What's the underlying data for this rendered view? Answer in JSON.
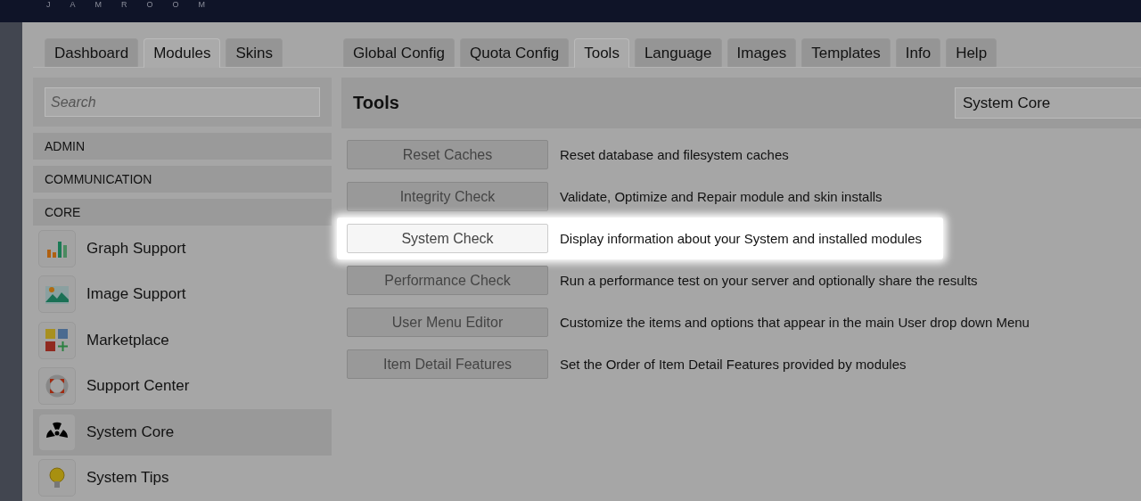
{
  "header": {
    "logo": "JAMROOM"
  },
  "left_tabs": [
    {
      "label": "Dashboard",
      "selected": false
    },
    {
      "label": "Modules",
      "selected": true
    },
    {
      "label": "Skins",
      "selected": false
    }
  ],
  "right_tabs": [
    {
      "label": "Global Config",
      "selected": false
    },
    {
      "label": "Quota Config",
      "selected": false
    },
    {
      "label": "Tools",
      "selected": true
    },
    {
      "label": "Language",
      "selected": false
    },
    {
      "label": "Images",
      "selected": false
    },
    {
      "label": "Templates",
      "selected": false
    },
    {
      "label": "Info",
      "selected": false
    },
    {
      "label": "Help",
      "selected": false
    }
  ],
  "sidebar": {
    "search": {
      "placeholder": "Search"
    },
    "categories": [
      "ADMIN",
      "COMMUNICATION",
      "CORE"
    ],
    "modules": [
      {
        "name": "Graph Support",
        "kind": "graph",
        "selected": false
      },
      {
        "name": "Image Support",
        "kind": "image",
        "selected": false
      },
      {
        "name": "Marketplace",
        "kind": "marketplace",
        "selected": false
      },
      {
        "name": "Support Center",
        "kind": "support",
        "selected": false
      },
      {
        "name": "System Core",
        "kind": "core",
        "selected": true
      },
      {
        "name": "System Tips",
        "kind": "tips",
        "selected": false
      }
    ]
  },
  "panel": {
    "title": "Tools",
    "module_select": "System Core",
    "tools": [
      {
        "button": "Reset Caches",
        "description": "Reset database and filesystem caches",
        "highlighted": false
      },
      {
        "button": "Integrity Check",
        "description": "Validate, Optimize and Repair module and skin installs",
        "highlighted": false
      },
      {
        "button": "System Check",
        "description": "Display information about your System and installed modules",
        "highlighted": true
      },
      {
        "button": "Performance Check",
        "description": "Run a performance test on your server and optionally share the results",
        "highlighted": false
      },
      {
        "button": "User Menu Editor",
        "description": "Customize the items and options that appear in the main User drop down Menu",
        "highlighted": false
      },
      {
        "button": "Item Detail Features",
        "description": "Set the Order of Item Detail Features provided by modules",
        "highlighted": false
      }
    ]
  }
}
